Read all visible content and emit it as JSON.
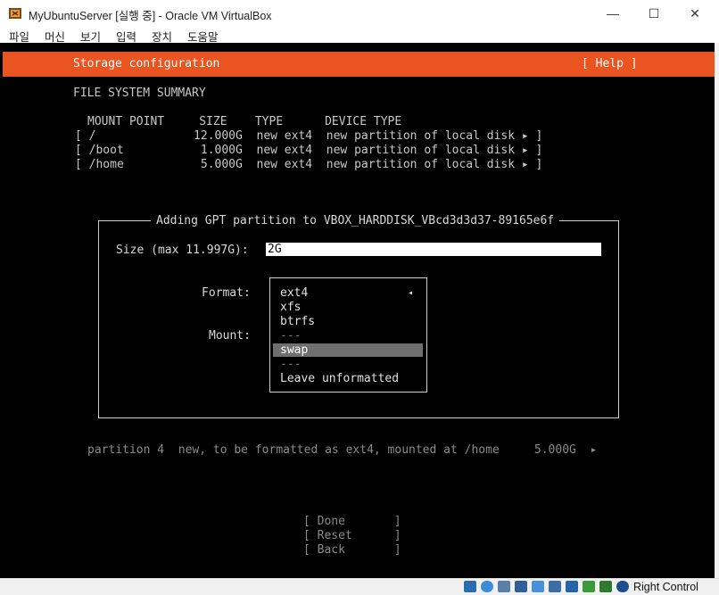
{
  "window": {
    "title": "MyUbuntuServer [실행 중] - Oracle VM VirtualBox",
    "minimize_icon": "minimize-icon",
    "maximize_icon": "maximize-icon",
    "close_icon": "close-icon",
    "minimize_glyph": "—",
    "maximize_glyph": "☐",
    "close_glyph": "✕"
  },
  "menu": {
    "items": [
      "파일",
      "머신",
      "보기",
      "입력",
      "장치",
      "도움말"
    ]
  },
  "screen": {
    "header_title": "Storage configuration",
    "help_label": "[ Help ]",
    "fs_summary_title": "FILE SYSTEM SUMMARY",
    "columns_header": "MOUNT POINT     SIZE    TYPE      DEVICE TYPE",
    "rows": [
      "[ /              12.000G  new ext4  new partition of local disk ▸ ]",
      "[ /boot           1.000G  new ext4  new partition of local disk ▸ ]",
      "[ /home           5.000G  new ext4  new partition of local disk ▸ ]"
    ],
    "partition_line": "partition 4  new, to be formatted as ext4, mounted at /home     5.000G  ▸",
    "buttons": [
      "[ Done       ]",
      "[ Reset      ]",
      "[ Back       ]"
    ]
  },
  "dialog": {
    "title": "Adding GPT partition to VBOX_HARDDISK_VBcd3d3d37-89165e6f",
    "size_label": "Size (max 11.997G):",
    "size_value": "2G",
    "format_label": "Format:",
    "mount_label": "Mount:",
    "options": [
      "ext4",
      "xfs",
      "btrfs",
      "---",
      "swap",
      "---",
      "Leave unformatted"
    ],
    "selected_option": "swap",
    "selected_glyph": "◂"
  },
  "statusbar": {
    "right_ctrl": "Right Control"
  },
  "colors": {
    "accent": "#e95420",
    "terminal_bg": "#000000"
  }
}
